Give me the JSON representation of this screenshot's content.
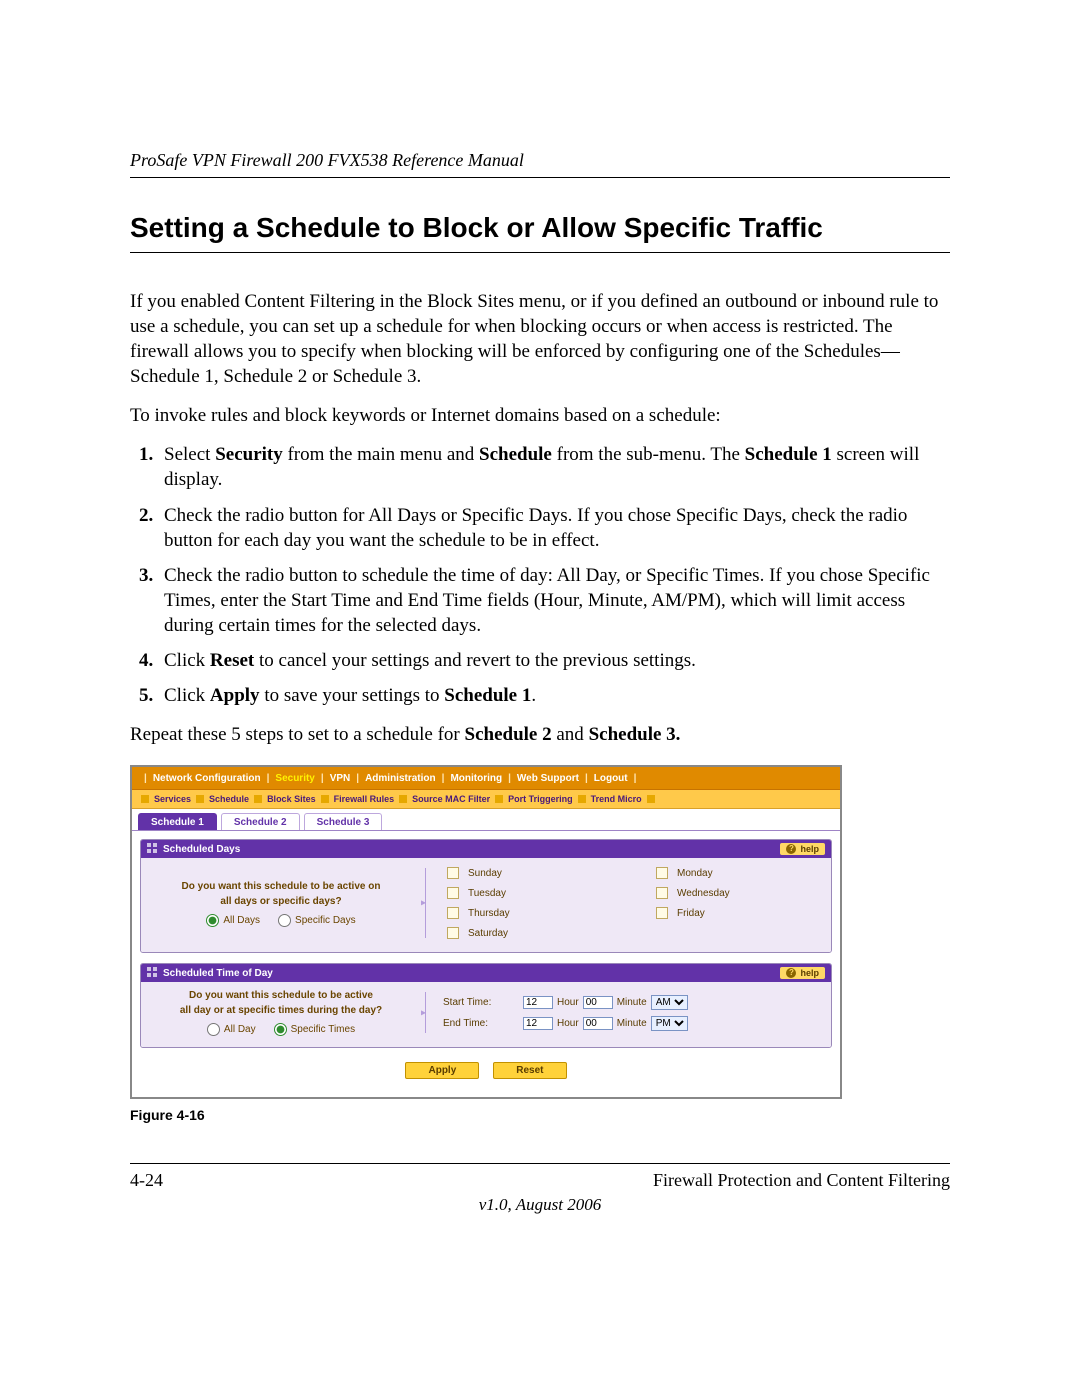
{
  "doc": {
    "running_head": "ProSafe VPN Firewall 200 FVX538 Reference Manual",
    "section_title": "Setting a Schedule to Block or Allow Specific Traffic",
    "para1": "If you enabled Content Filtering in the Block Sites menu, or if you defined an outbound or inbound rule to use a schedule, you can set up a schedule for when blocking occurs or when access is restricted. The firewall allows you to specify when blocking will be enforced by configuring one of the Schedules—Schedule 1, Schedule 2 or Schedule 3.",
    "para2": "To invoke rules and block keywords or Internet domains based on a schedule:",
    "steps": {
      "s1_a": "Select ",
      "s1_b": "Security",
      "s1_c": " from the main menu and ",
      "s1_d": "Schedule",
      "s1_e": " from the sub-menu. The ",
      "s1_f": "Schedule 1",
      "s1_g": " screen will display.",
      "s2": "Check the radio button for All Days or Specific Days. If you chose Specific Days, check the radio button for each day you want the schedule to be in effect.",
      "s3": "Check the radio button to schedule the time of day: All Day, or Specific Times. If you chose Specific Times, enter the Start Time and End Time fields (Hour, Minute, AM/PM), which will limit access during certain times for the selected days.",
      "s4_a": "Click ",
      "s4_b": "Reset",
      "s4_c": " to cancel your settings and revert to the previous settings.",
      "s5_a": "Click ",
      "s5_b": "Apply",
      "s5_c": " to save your settings to ",
      "s5_d": "Schedule 1",
      "s5_e": "."
    },
    "repeat_a": "Repeat these 5 steps to set to a schedule for ",
    "repeat_b": "Schedule 2",
    "repeat_c": " and ",
    "repeat_d": "Schedule 3.",
    "figure_caption": "Figure 4-16",
    "page_number": "4-24",
    "chapter": "Firewall Protection and Content Filtering",
    "version": "v1.0, August 2006"
  },
  "ui": {
    "mainmenu": [
      "Network Configuration",
      "Security",
      "VPN",
      "Administration",
      "Monitoring",
      "Web Support",
      "Logout"
    ],
    "mainmenu_active_index": 1,
    "submenu": [
      "Services",
      "Schedule",
      "Block Sites",
      "Firewall Rules",
      "Source MAC Filter",
      "Port Triggering",
      "Trend Micro"
    ],
    "submenu_active_index": 1,
    "tabs": [
      "Schedule 1",
      "Schedule 2",
      "Schedule 3"
    ],
    "tabs_active_index": 0,
    "panel_days": {
      "title": "Scheduled Days",
      "help": "help",
      "prompt_l1": "Do you want this schedule to be active on",
      "prompt_l2": "all days or specific days?",
      "radio_all": "All Days",
      "radio_specific": "Specific Days",
      "days": [
        "Sunday",
        "Monday",
        "Tuesday",
        "Wednesday",
        "Thursday",
        "Friday",
        "Saturday"
      ]
    },
    "panel_time": {
      "title": "Scheduled Time of Day",
      "help": "help",
      "prompt_l1": "Do you want this schedule to be active",
      "prompt_l2": "all day or at specific times during the day?",
      "radio_all": "All Day",
      "radio_specific": "Specific Times",
      "start_label": "Start Time:",
      "end_label": "End Time:",
      "hour_label": "Hour",
      "minute_label": "Minute",
      "start_hour": "12",
      "start_minute": "00",
      "start_ampm": "AM",
      "end_hour": "12",
      "end_minute": "00",
      "end_ampm": "PM"
    },
    "buttons": {
      "apply": "Apply",
      "reset": "Reset"
    }
  }
}
